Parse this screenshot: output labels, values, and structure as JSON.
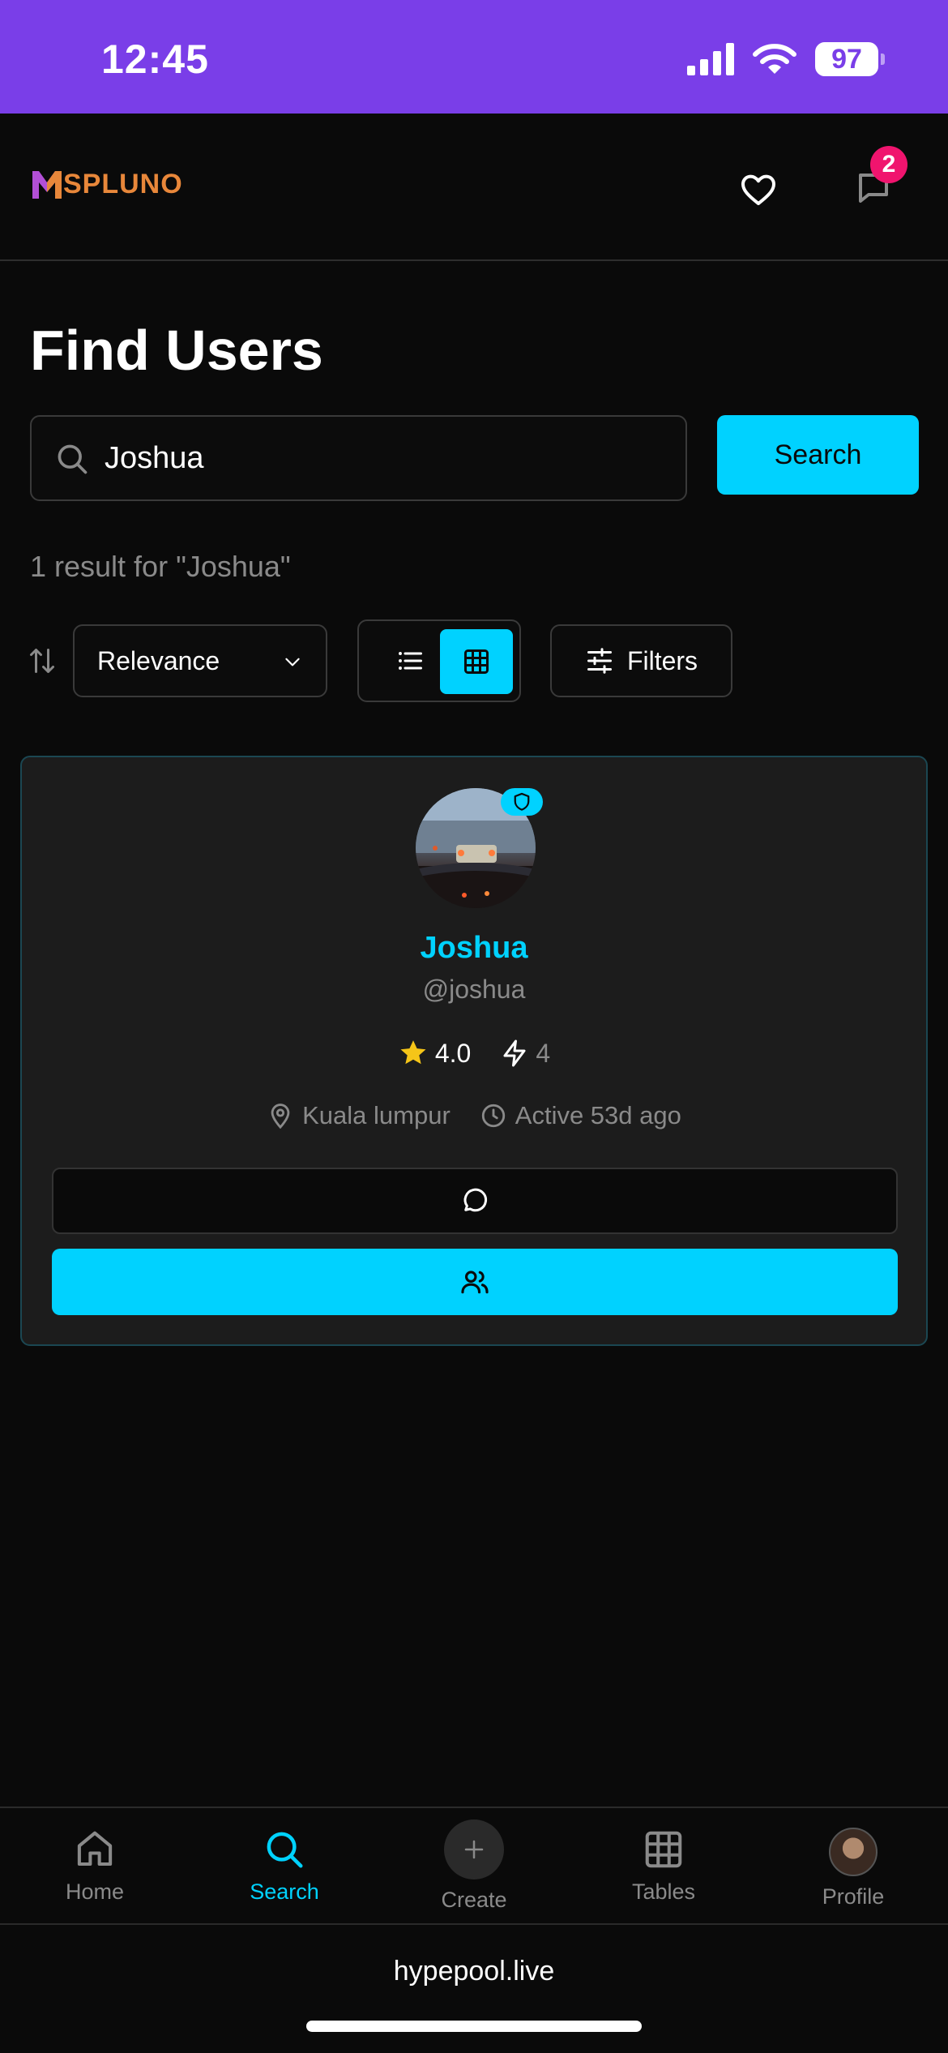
{
  "status_bar": {
    "time": "12:45",
    "battery": "97"
  },
  "header": {
    "logo_text": "SPLUNO",
    "notification_count": "2"
  },
  "page": {
    "title": "Find Users"
  },
  "search": {
    "value": "Joshua",
    "button_label": "Search",
    "result_text": "1 result for \"Joshua\""
  },
  "controls": {
    "sort_value": "Relevance",
    "filters_label": "Filters",
    "view_mode": "grid"
  },
  "user_card": {
    "name": "Joshua",
    "handle": "@joshua",
    "rating": "4.0",
    "boost_count": "4",
    "location": "Kuala lumpur",
    "activity": "Active 53d ago"
  },
  "nav": {
    "items": [
      {
        "label": "Home",
        "icon": "home-icon"
      },
      {
        "label": "Search",
        "icon": "search-icon",
        "active": true
      },
      {
        "label": "Create",
        "icon": "plus-icon"
      },
      {
        "label": "Tables",
        "icon": "grid-icon"
      },
      {
        "label": "Profile",
        "icon": "avatar"
      }
    ]
  },
  "browser": {
    "url": "hypepool.live"
  },
  "colors": {
    "accent": "#00d2ff",
    "status_bar": "#7a3ee8",
    "badge": "#f0146e",
    "star": "#f5c518"
  }
}
